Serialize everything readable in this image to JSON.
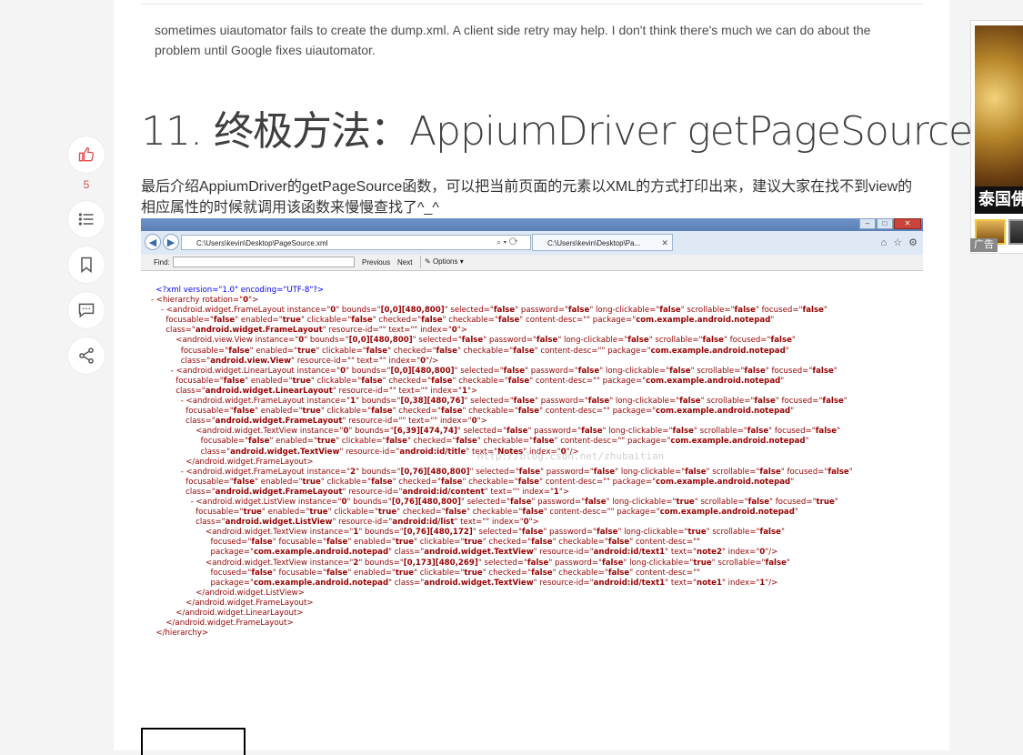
{
  "article": {
    "quote_text": "sometimes uiautomator fails to create the dump.xml. A client side retry may help. I don't think there's much we can do about the problem until Google fixes uiautomator.",
    "heading": "11. 终极方法：AppiumDriver getPageSource",
    "paragraph": "最后介绍AppiumDriver的getPageSource函数，可以把当前页面的元素以XML的方式打印出来，建议大家在找不到view的相应属性的时候就调用该函数来慢慢查找了^_^"
  },
  "toolbar": {
    "like_count": "5"
  },
  "browser": {
    "address": "C:\\Users\\kevin\\Desktop\\PageSource.xml",
    "tab_title": "C:\\Users\\kevin\\Desktop\\Pa...",
    "find_label": "Find:",
    "find_value": "",
    "prev_label": "Previous",
    "next_label": "Next",
    "options_label": "Options",
    "watermark": "http://blog.csdn.net/zhubaitian"
  },
  "xml_lines": [
    {
      "indent": "  ",
      "html": "<span class=\"b\">&lt;?xml version=\"1.0\" encoding=\"UTF-8\"?&gt;</span>"
    },
    {
      "indent": "",
      "html": "<span class=\"t\">- &lt;hierarchy rotation=\"<b>0</b>\"&gt;</span>"
    },
    {
      "indent": "    ",
      "html": "<span class=\"t\">- &lt;android.widget.FrameLayout instance=\"<b>0</b>\" bounds=\"<b>[0,0][480,800]</b>\" selected=\"<b>false</b>\" password=\"<b>false</b>\" long-clickable=\"<b>false</b>\" scrollable=\"<b>false</b>\" focused=\"<b>false</b>\"</span>"
    },
    {
      "indent": "      ",
      "html": "<span class=\"t\">focusable=\"<b>false</b>\" enabled=\"<b>true</b>\" clickable=\"<b>false</b>\" checked=\"<b>false</b>\" checkable=\"<b>false</b>\" content-desc=\"\" package=\"<b>com.example.android.notepad</b>\"</span>"
    },
    {
      "indent": "      ",
      "html": "<span class=\"t\">class=\"<b>android.widget.FrameLayout</b>\" resource-id=\"\" text=\"\" index=\"<b>0</b>\"&gt;</span>"
    },
    {
      "indent": "          ",
      "html": "<span class=\"t\">&lt;android.view.View instance=\"<b>0</b>\" bounds=\"<b>[0,0][480,800]</b>\" selected=\"<b>false</b>\" password=\"<b>false</b>\" long-clickable=\"<b>false</b>\" scrollable=\"<b>false</b>\" focused=\"<b>false</b>\"</span>"
    },
    {
      "indent": "            ",
      "html": "<span class=\"t\">focusable=\"<b>false</b>\" enabled=\"<b>true</b>\" clickable=\"<b>false</b>\" checked=\"<b>false</b>\" checkable=\"<b>false</b>\" content-desc=\"\" package=\"<b>com.example.android.notepad</b>\"</span>"
    },
    {
      "indent": "            ",
      "html": "<span class=\"t\">class=\"<b>android.view.View</b>\" resource-id=\"\" text=\"\" index=\"<b>0</b>\"/&gt;</span>"
    },
    {
      "indent": "        ",
      "html": "<span class=\"t\">- &lt;android.widget.LinearLayout instance=\"<b>0</b>\" bounds=\"<b>[0,0][480,800]</b>\" selected=\"<b>false</b>\" password=\"<b>false</b>\" long-clickable=\"<b>false</b>\" scrollable=\"<b>false</b>\" focused=\"<b>false</b>\"</span>"
    },
    {
      "indent": "          ",
      "html": "<span class=\"t\">focusable=\"<b>false</b>\" enabled=\"<b>true</b>\" clickable=\"<b>false</b>\" checked=\"<b>false</b>\" checkable=\"<b>false</b>\" content-desc=\"\" package=\"<b>com.example.android.notepad</b>\"</span>"
    },
    {
      "indent": "          ",
      "html": "<span class=\"t\">class=\"<b>android.widget.LinearLayout</b>\" resource-id=\"\" text=\"\" index=\"<b>1</b>\"&gt;</span>"
    },
    {
      "indent": "            ",
      "html": "<span class=\"t\">- &lt;android.widget.FrameLayout instance=\"<b>1</b>\" bounds=\"<b>[0,38][480,76]</b>\" selected=\"<b>false</b>\" password=\"<b>false</b>\" long-clickable=\"<b>false</b>\" scrollable=\"<b>false</b>\" focused=\"<b>false</b>\"</span>"
    },
    {
      "indent": "              ",
      "html": "<span class=\"t\">focusable=\"<b>false</b>\" enabled=\"<b>true</b>\" clickable=\"<b>false</b>\" checked=\"<b>false</b>\" checkable=\"<b>false</b>\" content-desc=\"\" package=\"<b>com.example.android.notepad</b>\"</span>"
    },
    {
      "indent": "              ",
      "html": "<span class=\"t\">class=\"<b>android.widget.FrameLayout</b>\" resource-id=\"\" text=\"\" index=\"<b>0</b>\"&gt;</span>"
    },
    {
      "indent": "                  ",
      "html": "<span class=\"t\">&lt;android.widget.TextView instance=\"<b>0</b>\" bounds=\"<b>[6,39][474,74]</b>\" selected=\"<b>false</b>\" password=\"<b>false</b>\" long-clickable=\"<b>false</b>\" scrollable=\"<b>false</b>\" focused=\"<b>false</b>\"</span>"
    },
    {
      "indent": "                    ",
      "html": "<span class=\"t\">focusable=\"<b>false</b>\" enabled=\"<b>true</b>\" clickable=\"<b>false</b>\" checked=\"<b>false</b>\" checkable=\"<b>false</b>\" content-desc=\"\" package=\"<b>com.example.android.notepad</b>\"</span>"
    },
    {
      "indent": "                    ",
      "html": "<span class=\"t\">class=\"<b>android.widget.TextView</b>\" resource-id=\"<b>android:id/title</b>\" text=\"<b>Notes</b>\" index=\"<b>0</b>\"/&gt;</span>"
    },
    {
      "indent": "              ",
      "html": "<span class=\"t\">&lt;/android.widget.FrameLayout&gt;</span>"
    },
    {
      "indent": "            ",
      "html": "<span class=\"t\">- &lt;android.widget.FrameLayout instance=\"<b>2</b>\" bounds=\"<b>[0,76][480,800]</b>\" selected=\"<b>false</b>\" password=\"<b>false</b>\" long-clickable=\"<b>false</b>\" scrollable=\"<b>false</b>\" focused=\"<b>false</b>\"</span>"
    },
    {
      "indent": "              ",
      "html": "<span class=\"t\">focusable=\"<b>false</b>\" enabled=\"<b>true</b>\" clickable=\"<b>false</b>\" checked=\"<b>false</b>\" checkable=\"<b>false</b>\" content-desc=\"\" package=\"<b>com.example.android.notepad</b>\"</span>"
    },
    {
      "indent": "              ",
      "html": "<span class=\"t\">class=\"<b>android.widget.FrameLayout</b>\" resource-id=\"<b>android:id/content</b>\" text=\"\" index=\"<b>1</b>\"&gt;</span>"
    },
    {
      "indent": "                ",
      "html": "<span class=\"t\">- &lt;android.widget.ListView instance=\"<b>0</b>\" bounds=\"<b>[0,76][480,800]</b>\" selected=\"<b>false</b>\" password=\"<b>false</b>\" long-clickable=\"<b>true</b>\" scrollable=\"<b>false</b>\" focused=\"<b>true</b>\"</span>"
    },
    {
      "indent": "                  ",
      "html": "<span class=\"t\">focusable=\"<b>true</b>\" enabled=\"<b>true</b>\" clickable=\"<b>true</b>\" checked=\"<b>false</b>\" checkable=\"<b>false</b>\" content-desc=\"\" package=\"<b>com.example.android.notepad</b>\"</span>"
    },
    {
      "indent": "                  ",
      "html": "<span class=\"t\">class=\"<b>android.widget.ListView</b>\" resource-id=\"<b>android:id/list</b>\" text=\"\" index=\"<b>0</b>\"&gt;</span>"
    },
    {
      "indent": "                      ",
      "html": "<span class=\"t\">&lt;android.widget.TextView instance=\"<b>1</b>\" bounds=\"<b>[0,76][480,172]</b>\" selected=\"<b>false</b>\" password=\"<b>false</b>\" long-clickable=\"<b>true</b>\" scrollable=\"<b>false</b>\"</span>"
    },
    {
      "indent": "                        ",
      "html": "<span class=\"t\">focused=\"<b>false</b>\" focusable=\"<b>false</b>\" enabled=\"<b>true</b>\" clickable=\"<b>true</b>\" checked=\"<b>false</b>\" checkable=\"<b>false</b>\" content-desc=\"\"</span>"
    },
    {
      "indent": "                        ",
      "html": "<span class=\"t\">package=\"<b>com.example.android.notepad</b>\" class=\"<b>android.widget.TextView</b>\" resource-id=\"<b>android:id/text1</b>\" text=\"<b>note2</b>\" index=\"<b>0</b>\"/&gt;</span>"
    },
    {
      "indent": "                      ",
      "html": "<span class=\"t\">&lt;android.widget.TextView instance=\"<b>2</b>\" bounds=\"<b>[0,173][480,269]</b>\" selected=\"<b>false</b>\" password=\"<b>false</b>\" long-clickable=\"<b>true</b>\" scrollable=\"<b>false</b>\"</span>"
    },
    {
      "indent": "                        ",
      "html": "<span class=\"t\">focused=\"<b>false</b>\" focusable=\"<b>false</b>\" enabled=\"<b>true</b>\" clickable=\"<b>true</b>\" checked=\"<b>false</b>\" checkable=\"<b>false</b>\" content-desc=\"\"</span>"
    },
    {
      "indent": "                        ",
      "html": "<span class=\"t\">package=\"<b>com.example.android.notepad</b>\" class=\"<b>android.widget.TextView</b>\" resource-id=\"<b>android:id/text1</b>\" text=\"<b>note1</b>\" index=\"<b>1</b>\"/&gt;</span>"
    },
    {
      "indent": "                  ",
      "html": "<span class=\"t\">&lt;/android.widget.ListView&gt;</span>"
    },
    {
      "indent": "              ",
      "html": "<span class=\"t\">&lt;/android.widget.FrameLayout&gt;</span>"
    },
    {
      "indent": "          ",
      "html": "<span class=\"t\">&lt;/android.widget.LinearLayout&gt;</span>"
    },
    {
      "indent": "      ",
      "html": "<span class=\"t\">&lt;/android.widget.FrameLayout&gt;</span>"
    },
    {
      "indent": "  ",
      "html": "<span class=\"t\">&lt;/hierarchy&gt;</span>"
    }
  ],
  "ad": {
    "title": "泰国佛",
    "label": "广告"
  },
  "icons": {
    "like": "thumbs-up-icon",
    "toc": "list-icon",
    "bookmark": "bookmark-icon",
    "comment": "comment-icon",
    "share": "share-icon"
  }
}
